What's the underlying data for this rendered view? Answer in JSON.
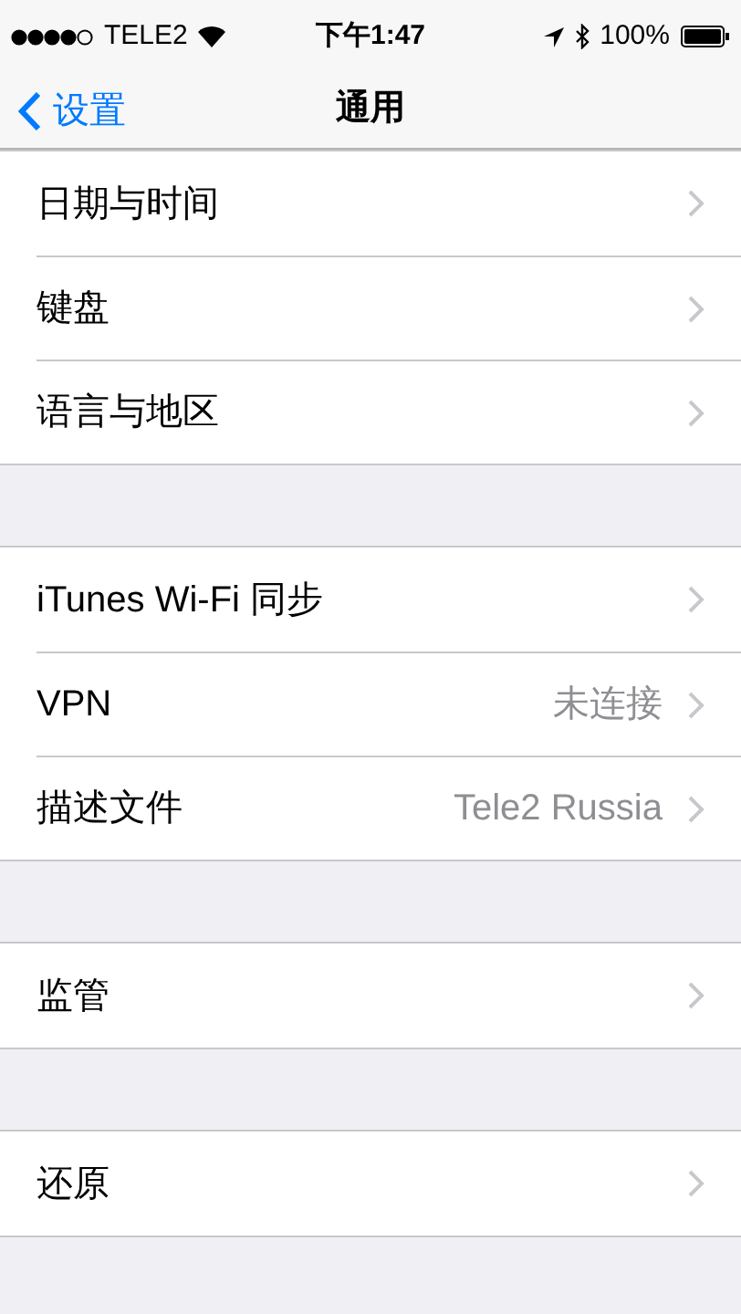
{
  "status_bar": {
    "carrier": "TELE2",
    "time": "下午1:47",
    "battery": "100%"
  },
  "nav": {
    "back": "设置",
    "title": "通用"
  },
  "groups": [
    {
      "rows": [
        {
          "label": "日期与时间"
        },
        {
          "label": "键盘"
        },
        {
          "label": "语言与地区"
        }
      ]
    },
    {
      "rows": [
        {
          "label": "iTunes Wi-Fi 同步"
        },
        {
          "label": "VPN",
          "value": "未连接"
        },
        {
          "label": "描述文件",
          "value": "Tele2 Russia"
        }
      ]
    },
    {
      "rows": [
        {
          "label": "监管"
        }
      ]
    },
    {
      "rows": [
        {
          "label": "还原"
        }
      ]
    }
  ]
}
